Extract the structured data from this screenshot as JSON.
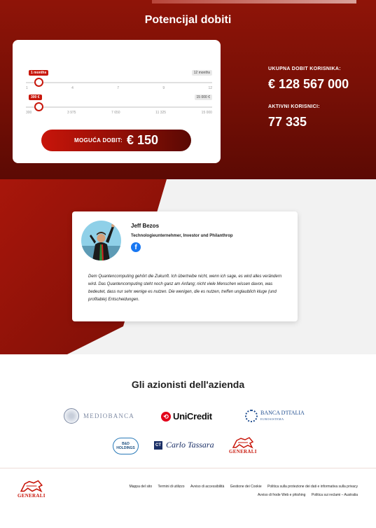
{
  "hero": {
    "title": "Potencijal dobiti",
    "calculator": {
      "slider_months": {
        "value_badge": "1 months",
        "max_badge": "12 months",
        "ticks": [
          "1",
          "4",
          "7",
          "9",
          "12"
        ],
        "fraction": 0.0
      },
      "slider_amount": {
        "value_badge": "300 €",
        "max_badge": "15 000 €",
        "ticks": [
          "300",
          "3 975",
          "7 650",
          "11 325",
          "15 000"
        ],
        "fraction": 0.0
      },
      "cta_label": "MOGUĆA DOBIT:",
      "cta_value": "€ 150"
    },
    "stats": {
      "total_label": "UKUPNA DOBIT KORISNIKA:",
      "total_value": "€ 128 567 000",
      "users_label": "AKTIVNI KORISNICI:",
      "users_value": "77 335"
    }
  },
  "testimonial": {
    "name": "Jeff Bezos",
    "role": "Technologieunternehmer, Investor und Philanthrop",
    "social_icon": "facebook-icon",
    "quote": "Dem Quantencomputing gehört die Zukunft. Ich übertreibe nicht, wenn ich sage, es wird alles verändern wird. Das Quantencomputing steht noch ganz am Anfang; nicht viele Menschen wissen davon, was bedeutet, dass nur sehr wenige es nutzen. Die wenigen, die es nutzen, treffen unglaublich kluge (und profitable) Entscheidungen."
  },
  "shareholders": {
    "title": "Gli azionisti dell'azienda",
    "logos": {
      "mediobanca": "MEDIOBANCA",
      "unicredit": "UniCredit",
      "bancaditalia_line1": "BANCA D'ITALIA",
      "bancaditalia_line2": "EUROSISTEMA",
      "bd_line1": "B&D",
      "bd_line2": "HOLDINGS",
      "carlo": "Carlo Tassara",
      "generali": "GENERALI"
    }
  },
  "footer": {
    "logo_text": "GENERALI",
    "links_row1": [
      "Mappa del sito",
      "Termini di utilizzo",
      "Avviso di accessibilità",
      "Gestione dei Cookie",
      "Politica sulla protezione dei dati e informativa sulla privacy"
    ],
    "links_row2": [
      "Avviso di frode Web e phishing",
      "Politica sui reclami – Australia"
    ]
  },
  "colors": {
    "brand_red": "#c8170b",
    "hero_dark": "#5c0a04",
    "facebook_blue": "#1877f2"
  }
}
